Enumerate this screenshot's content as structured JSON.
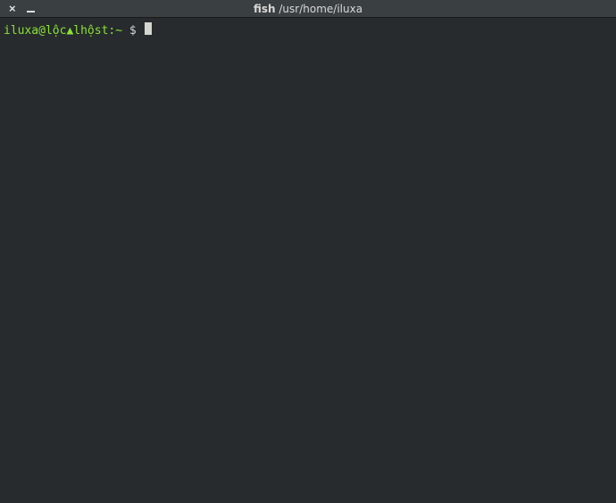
{
  "titlebar": {
    "close_label": "×",
    "title_app": "fish",
    "title_path": "/usr/home/iluxa"
  },
  "terminal": {
    "prompt_userhost": "iluxa@lộc▲lhộst:~",
    "prompt_symbol": " $ ",
    "input_value": ""
  }
}
